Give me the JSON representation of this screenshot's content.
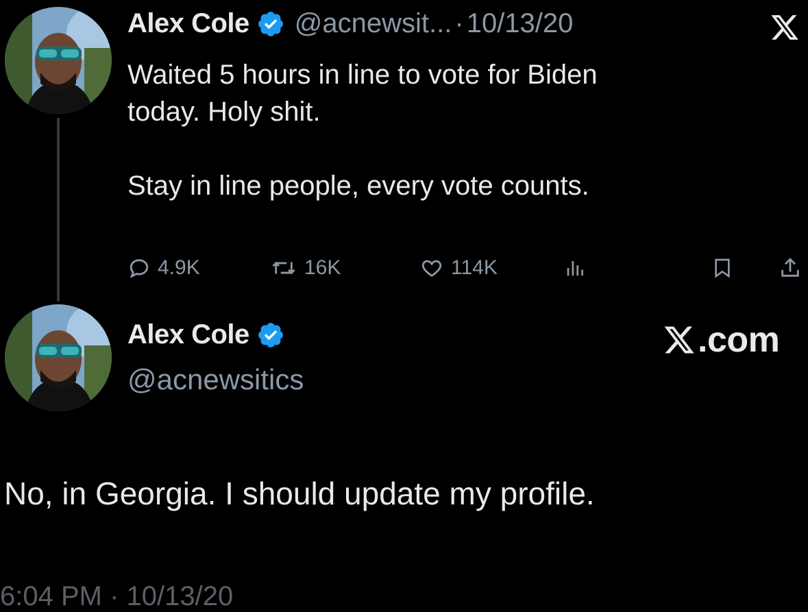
{
  "tweet": {
    "author_name": "Alex Cole",
    "handle": "@acnewsit...",
    "separator": "·",
    "date": "10/13/20",
    "text_line1": "Waited 5 hours in line to vote for Biden",
    "text_line2": "today. Holy shit.",
    "text_line3": "Stay in line people, every vote counts.",
    "replies": "4.9K",
    "reposts": "16K",
    "likes": "114K"
  },
  "profile_card": {
    "author_name": "Alex Cole",
    "handle": "@acnewsitics",
    "brand": ".com"
  },
  "reply": {
    "text": "No, in Georgia. I should update my profile.",
    "timestamp": "6:04 PM · 10/13/20"
  },
  "icons": {
    "verified": "verified-badge-icon",
    "reply": "reply-icon",
    "repost": "repost-icon",
    "like": "heart-icon",
    "views": "views-icon",
    "bookmark": "bookmark-icon",
    "share": "share-icon",
    "x_logo": "x-logo-icon"
  },
  "colors": {
    "background": "#000000",
    "text": "#e7e9ea",
    "muted": "#8b98a5",
    "verified": "#1d9bf0"
  }
}
